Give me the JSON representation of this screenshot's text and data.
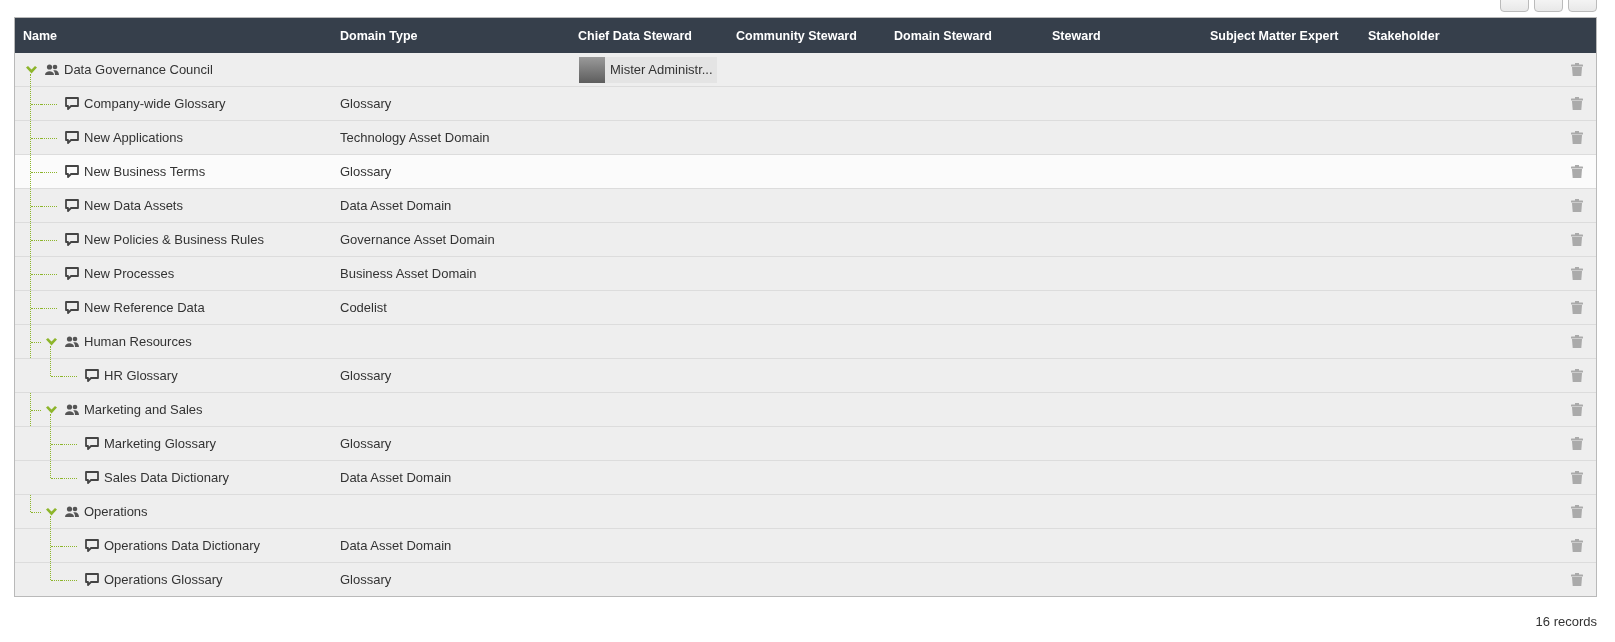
{
  "columns": [
    "Name",
    "Domain Type",
    "Chief Data Steward",
    "Community Steward",
    "Domain Steward",
    "Steward",
    "Subject Matter Expert",
    "Stakeholder"
  ],
  "rows": [
    {
      "kind": "community",
      "name": "Data Governance Council",
      "expanded": true,
      "highlighted": false,
      "chief_data_steward": {
        "name": "Mister Administr..."
      },
      "children": [
        {
          "kind": "domain",
          "name": "Company-wide Glossary",
          "domain_type": "Glossary",
          "highlighted": false
        },
        {
          "kind": "domain",
          "name": "New Applications",
          "domain_type": "Technology Asset Domain",
          "highlighted": false
        },
        {
          "kind": "domain",
          "name": "New Business Terms",
          "domain_type": "Glossary",
          "highlighted": true
        },
        {
          "kind": "domain",
          "name": "New Data Assets",
          "domain_type": "Data Asset Domain",
          "highlighted": false
        },
        {
          "kind": "domain",
          "name": "New Policies & Business Rules",
          "domain_type": "Governance Asset Domain",
          "highlighted": false
        },
        {
          "kind": "domain",
          "name": "New Processes",
          "domain_type": "Business Asset Domain",
          "highlighted": false
        },
        {
          "kind": "domain",
          "name": "New Reference Data",
          "domain_type": "Codelist",
          "highlighted": false
        },
        {
          "kind": "community",
          "name": "Human Resources",
          "expanded": true,
          "highlighted": false,
          "children": [
            {
              "kind": "domain",
              "name": "HR Glossary",
              "domain_type": "Glossary",
              "highlighted": false
            }
          ]
        },
        {
          "kind": "community",
          "name": "Marketing and Sales",
          "expanded": true,
          "highlighted": false,
          "children": [
            {
              "kind": "domain",
              "name": "Marketing Glossary",
              "domain_type": "Glossary",
              "highlighted": false
            },
            {
              "kind": "domain",
              "name": "Sales Data Dictionary",
              "domain_type": "Data Asset Domain",
              "highlighted": false
            }
          ]
        },
        {
          "kind": "community",
          "name": "Operations",
          "expanded": true,
          "highlighted": false,
          "children": [
            {
              "kind": "domain",
              "name": "Operations Data Dictionary",
              "domain_type": "Data Asset Domain",
              "highlighted": false
            },
            {
              "kind": "domain",
              "name": "Operations Glossary",
              "domain_type": "Glossary",
              "highlighted": false
            }
          ]
        }
      ]
    }
  ],
  "footer": "16 records"
}
